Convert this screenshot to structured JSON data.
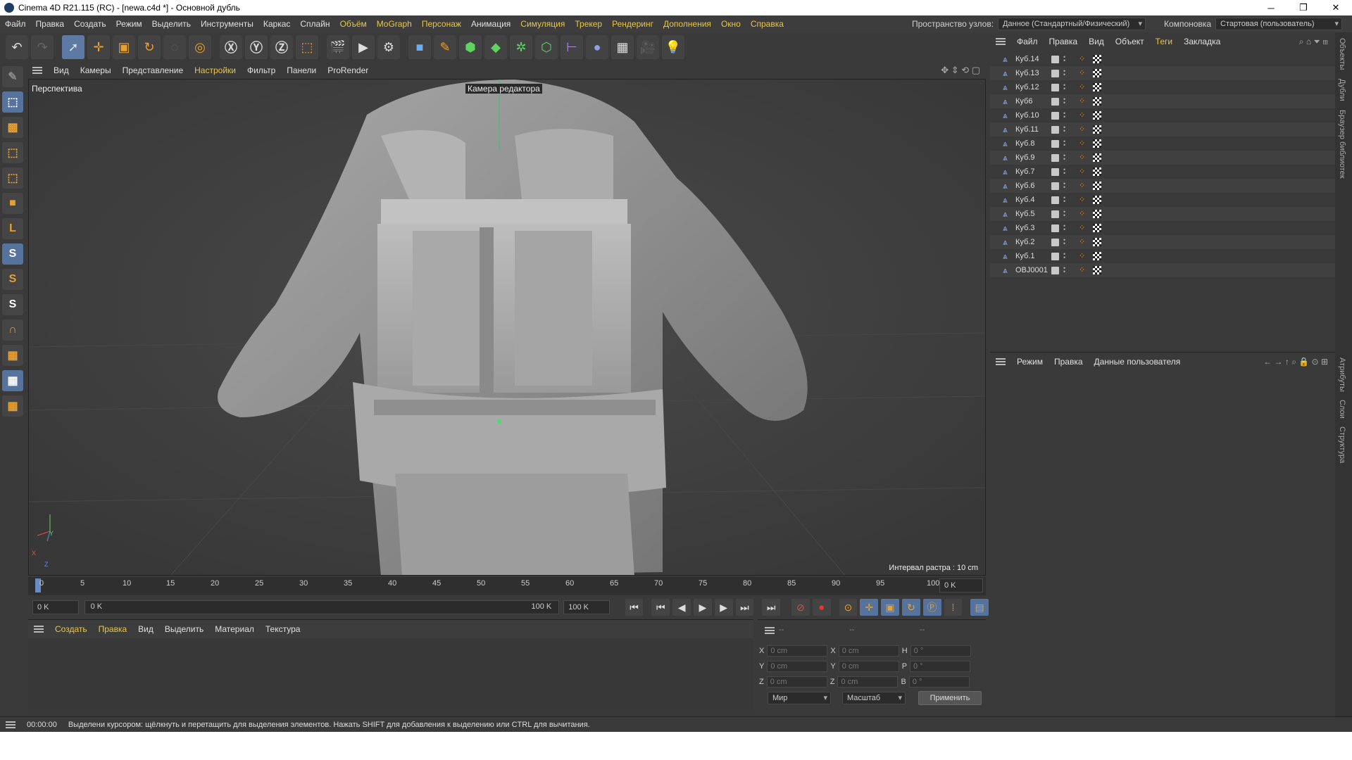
{
  "window": {
    "title": "Cinema 4D R21.115 (RC) - [newa.c4d *] - Основной дубль",
    "controls": [
      "─",
      "❐",
      "✕"
    ]
  },
  "menubar": {
    "items": [
      "Файл",
      "Правка",
      "Создать",
      "Режим",
      "Выделить",
      "Инструменты",
      "Каркас",
      "Сплайн",
      "Объём",
      "MoGraph",
      "Персонаж",
      "Анимация",
      "Симуляция",
      "Трекер",
      "Рендеринг",
      "Дополнения",
      "Окно",
      "Справка"
    ],
    "node_space_label": "Пространство узлов:",
    "node_space_value": "Данное (Стандартный/Физический)",
    "layout_label": "Компоновка",
    "layout_value": "Стартовая (пользователь)"
  },
  "viewport": {
    "menu": [
      "Вид",
      "Камеры",
      "Представление",
      "Настройки",
      "Фильтр",
      "Панели",
      "ProRender"
    ],
    "view_name": "Перспектива",
    "camera_label": "Камера редактора",
    "grid_interval": "Интервал растра : 10 cm",
    "axis_x": "X",
    "axis_y": "Y",
    "axis_z": "Z"
  },
  "timeline": {
    "ticks": [
      "0",
      "5",
      "10",
      "15",
      "20",
      "25",
      "30",
      "35",
      "40",
      "45",
      "50",
      "55",
      "60",
      "65",
      "70",
      "75",
      "80",
      "85",
      "90",
      "95",
      "100"
    ],
    "current_frame": "0 K",
    "start_field": "0 K",
    "range_start": "0 K",
    "range_end": "100 K",
    "end_field": "100 K"
  },
  "material_panel": {
    "menu": [
      "Создать",
      "Правка",
      "Вид",
      "Выделить",
      "Материал",
      "Текстура"
    ]
  },
  "coordinates": {
    "headers": [
      "--",
      "--",
      "--"
    ],
    "rows": [
      {
        "a": "X",
        "av": "0 cm",
        "b": "X",
        "bv": "0 cm",
        "c": "H",
        "cv": "0 °"
      },
      {
        "a": "Y",
        "av": "0 cm",
        "b": "Y",
        "bv": "0 cm",
        "c": "P",
        "cv": "0 °"
      },
      {
        "a": "Z",
        "av": "0 cm",
        "b": "Z",
        "bv": "0 cm",
        "c": "B",
        "cv": "0 °"
      }
    ],
    "mode_world": "Мир",
    "mode_scale": "Масштаб",
    "apply_button": "Применить"
  },
  "status": {
    "time": "00:00:00",
    "message": "Выделени курсором: щёлкнуть и перетащить для выделения элементов. Нажать SHIFT для добавления к выделению или CTRL для вычитания."
  },
  "objects_panel": {
    "menu": [
      "Файл",
      "Правка",
      "Вид",
      "Объект",
      "Теги",
      "Закладка"
    ],
    "items": [
      "Куб.14",
      "Куб.13",
      "Куб.12",
      "Куб6",
      "Куб.10",
      "Куб.11",
      "Куб.8",
      "Куб.9",
      "Куб.7",
      "Куб.6",
      "Куб.4",
      "Куб.5",
      "Куб.3",
      "Куб.2",
      "Куб.1",
      "OBJ0001"
    ]
  },
  "attributes_panel": {
    "menu": [
      "Режим",
      "Правка",
      "Данные пользователя"
    ]
  },
  "right_tabs": [
    "Объекты",
    "Дубли",
    "Браузер библиотек",
    "Атрибуты",
    "Слои",
    "Структура"
  ]
}
